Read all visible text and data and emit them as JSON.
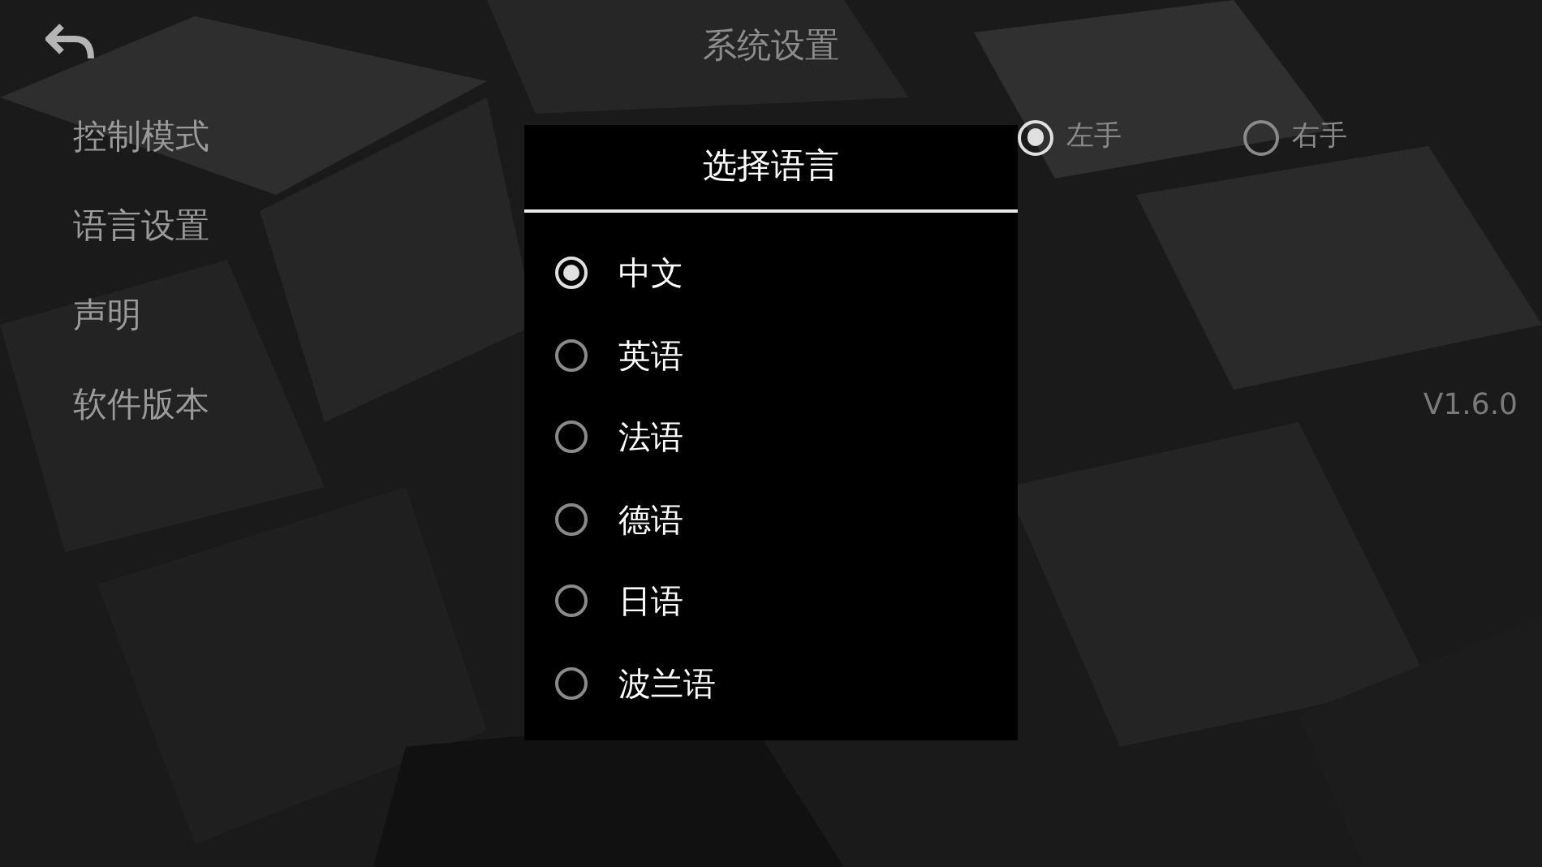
{
  "header": {
    "title": "系统设置"
  },
  "settings": [
    {
      "label": "控制模式",
      "kind": "radio",
      "options": [
        {
          "label": "左手",
          "selected": true
        },
        {
          "label": "右手",
          "selected": false
        }
      ]
    },
    {
      "label": "语言设置",
      "kind": "plain"
    },
    {
      "label": "声明",
      "kind": "plain"
    },
    {
      "label": "软件版本",
      "kind": "value",
      "value": "V1.6.0"
    }
  ],
  "dialog": {
    "title": "选择语言",
    "options": [
      {
        "label": "中文",
        "selected": true
      },
      {
        "label": "英语",
        "selected": false
      },
      {
        "label": "法语",
        "selected": false
      },
      {
        "label": "德语",
        "selected": false
      },
      {
        "label": "日语",
        "selected": false
      },
      {
        "label": "波兰语",
        "selected": false
      }
    ]
  }
}
